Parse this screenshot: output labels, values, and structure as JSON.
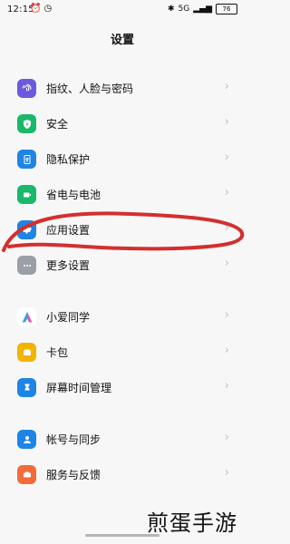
{
  "status": {
    "time": "12:15",
    "battery": "76",
    "left_icons": [
      "alarm-icon",
      "clock-icon"
    ],
    "right_icons": [
      "bluetooth-icon",
      "mobile-data-icon",
      "signal-icon"
    ]
  },
  "page": {
    "title": "设置"
  },
  "settings": {
    "groups": [
      {
        "items": [
          {
            "label": "指纹、人脸与密码",
            "icon": "fingerprint-icon",
            "color": "#6a5bde"
          },
          {
            "label": "安全",
            "icon": "shield-bolt-icon",
            "color": "#19b86b"
          },
          {
            "label": "隐私保护",
            "icon": "privacy-icon",
            "color": "#1e84e6"
          },
          {
            "label": "省电与电池",
            "icon": "battery-icon",
            "color": "#19b86b"
          },
          {
            "label": "应用设置",
            "icon": "gear-icon",
            "color": "#1e84e6"
          },
          {
            "label": "更多设置",
            "icon": "more-icon",
            "color": "#9aa0a6"
          }
        ]
      },
      {
        "items": [
          {
            "label": "小爱同学",
            "icon": "assistant-icon",
            "color": "#ffffff"
          },
          {
            "label": "卡包",
            "icon": "wallet-icon",
            "color": "#f2b400"
          },
          {
            "label": "屏幕时间管理",
            "icon": "hourglass-icon",
            "color": "#1e84e6"
          }
        ]
      },
      {
        "items": [
          {
            "label": "帐号与同步",
            "icon": "account-icon",
            "color": "#1e84e6"
          },
          {
            "label": "服务与反馈",
            "icon": "feedback-icon",
            "color": "#f26b3a"
          }
        ]
      }
    ]
  },
  "overlay": {
    "watermark": "煎蛋手游",
    "annotation_color": "#d32f2f"
  }
}
